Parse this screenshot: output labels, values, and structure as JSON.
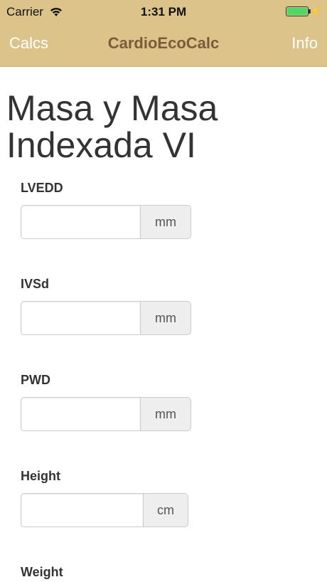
{
  "status_bar": {
    "carrier": "Carrier",
    "time": "1:31 PM",
    "battery_level": 1.0,
    "wifi_icon": "wifi-icon",
    "charging_icon": "bolt-icon"
  },
  "nav": {
    "left_label": "Calcs",
    "title": "CardioEcoCalc",
    "right_label": "Info"
  },
  "page": {
    "title": "Masa y Masa Indexada VI"
  },
  "fields": [
    {
      "label": "LVEDD",
      "value": "",
      "placeholder": "",
      "unit": "mm"
    },
    {
      "label": "IVSd",
      "value": "",
      "placeholder": "",
      "unit": "mm"
    },
    {
      "label": "PWD",
      "value": "",
      "placeholder": "",
      "unit": "mm"
    },
    {
      "label": "Height",
      "value": "",
      "placeholder": "",
      "unit": "cm"
    },
    {
      "label": "Weight",
      "value": "",
      "placeholder": "",
      "unit": ""
    }
  ],
  "colors": {
    "nav_background": "#dcc38a",
    "nav_title": "#7a5c3a",
    "nav_buttons": "#ffffff",
    "battery_fill": "#4cd964"
  }
}
